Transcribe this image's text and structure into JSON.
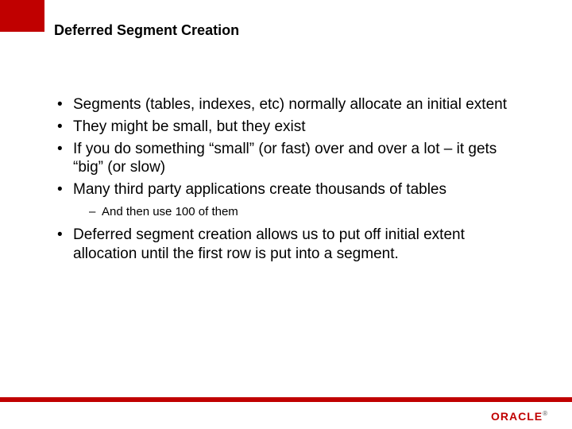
{
  "slide": {
    "title": "Deferred Segment Creation",
    "bullets": [
      {
        "text": "Segments (tables, indexes, etc) normally allocate an initial extent"
      },
      {
        "text": "They might be small, but they exist"
      },
      {
        "text": "If you do something “small” (or fast) over and over a lot – it gets “big” (or slow)"
      },
      {
        "text": "Many third party applications create thousands of tables",
        "sub": [
          {
            "text": "And then use 100 of them"
          }
        ]
      },
      {
        "text": "Deferred segment creation allows us to put off initial extent allocation until the first row is put into a segment."
      }
    ]
  },
  "branding": {
    "logo_text": "ORACLE",
    "logo_reg": "®"
  },
  "colors": {
    "brand_red": "#c00000"
  }
}
